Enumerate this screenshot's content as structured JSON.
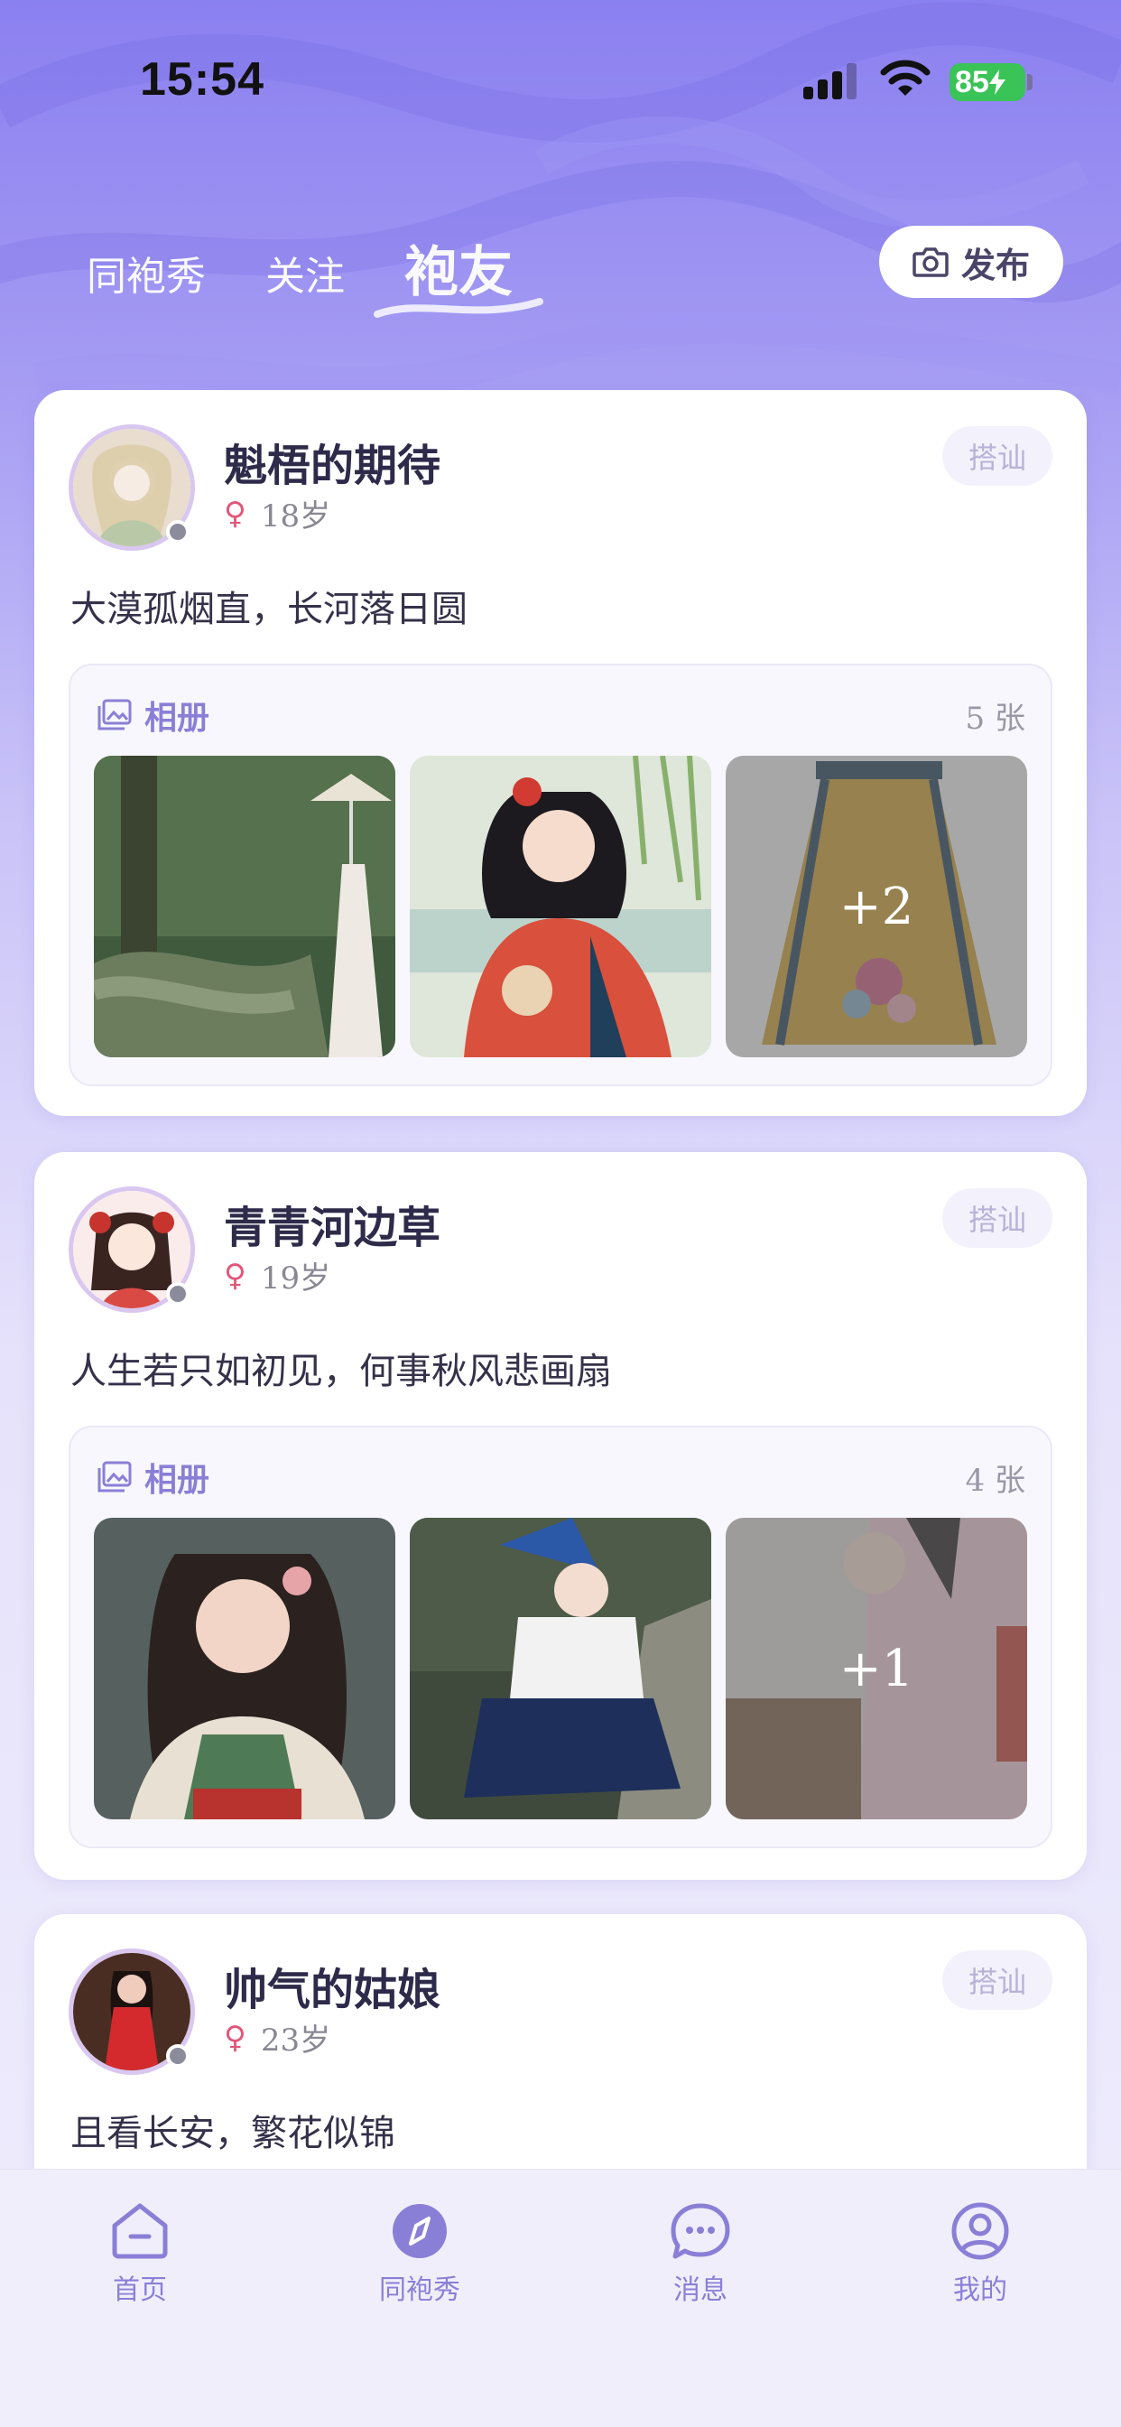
{
  "status_bar": {
    "time": "15:54",
    "battery": "85"
  },
  "header": {
    "tabs": [
      {
        "label": "同袍秀"
      },
      {
        "label": "关注"
      },
      {
        "label": "袍友"
      }
    ],
    "publish_label": "发布"
  },
  "colors": {
    "accent": "#8a7fd6",
    "header_bg": "#8b80f0",
    "female": "#e2567a"
  },
  "cards": [
    {
      "name": "魁梧的期待",
      "gender_icon": "♀",
      "age": "18岁",
      "chat_label": "搭讪",
      "bio": "大漠孤烟直，长河落日圆",
      "album_title": "相册",
      "album_count": "5 张",
      "more": "+2"
    },
    {
      "name": "青青河边草",
      "gender_icon": "♀",
      "age": "19岁",
      "chat_label": "搭讪",
      "bio": "人生若只如初见，何事秋风悲画扇",
      "album_title": "相册",
      "album_count": "4 张",
      "more": "+1"
    },
    {
      "name": "帅气的姑娘",
      "gender_icon": "♀",
      "age": "23岁",
      "chat_label": "搭讪",
      "bio": "且看长安，繁花似锦"
    }
  ],
  "bottom_nav": [
    {
      "label": "首页",
      "icon": "home-icon"
    },
    {
      "label": "同袍秀",
      "icon": "compass-icon"
    },
    {
      "label": "消息",
      "icon": "message-icon"
    },
    {
      "label": "我的",
      "icon": "profile-icon"
    }
  ]
}
